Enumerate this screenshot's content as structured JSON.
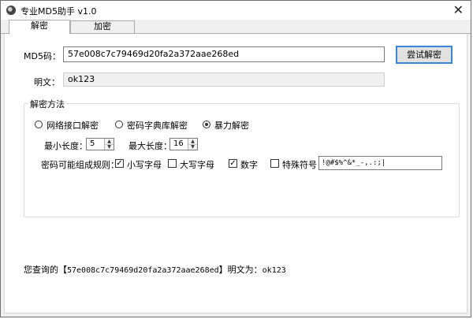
{
  "window": {
    "title": "专业MD5助手 v1.0",
    "close_glyph": "✕"
  },
  "tabs": [
    {
      "label": "解密",
      "active": true
    },
    {
      "label": "加密",
      "active": false
    }
  ],
  "form": {
    "md5_label": "MD5码：",
    "md5_value": "57e008c7c79469d20fa2a372aae268ed",
    "try_button": "尝试解密",
    "plain_label": "明文：",
    "plain_value": "ok123"
  },
  "method": {
    "group_title": "解密方法",
    "options": [
      {
        "label": "网络接口解密",
        "checked": false
      },
      {
        "label": "密码字典库解密",
        "checked": false
      },
      {
        "label": "暴力解密",
        "checked": true
      }
    ],
    "min_length_label": "最小长度：",
    "min_length": "5",
    "max_length_label": "最大长度：",
    "max_length": "16",
    "rules_label": "密码可能组成规则：",
    "rules": [
      {
        "label": "小写字母",
        "checked": true
      },
      {
        "label": "大写字母",
        "checked": false
      },
      {
        "label": "数字",
        "checked": true
      },
      {
        "label": "特殊符号",
        "checked": false
      }
    ],
    "special_chars": "!@#$%^&*_-,.:;|"
  },
  "result": {
    "prefix": "您查询的【",
    "hash": "57e008c7c79469d20fa2a372aae268ed",
    "middle": "】明文为：",
    "plain": "ok123"
  },
  "colors": {
    "accent_border": "#3d86d6",
    "window_bg": "#f0f0f0"
  }
}
